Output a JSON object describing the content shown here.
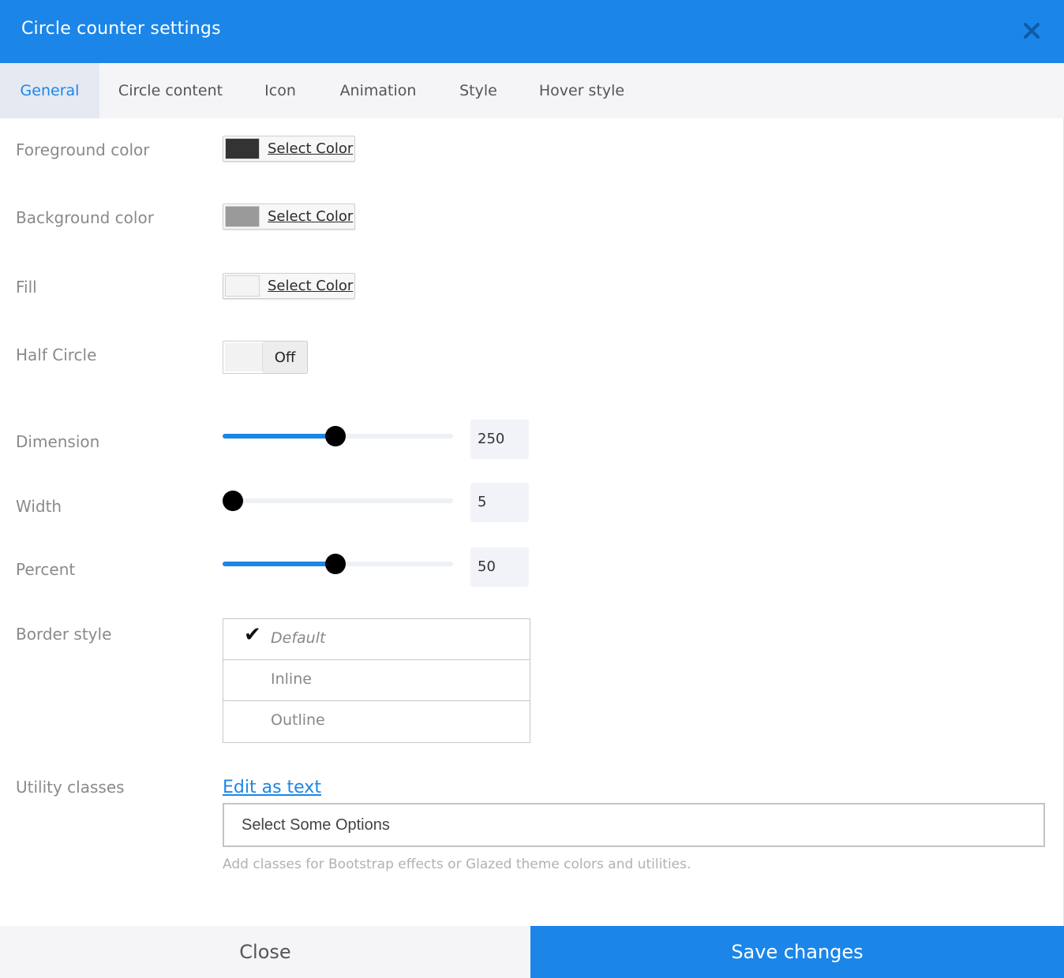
{
  "dialog": {
    "title": "Circle counter settings",
    "close_icon": "close-x-icon"
  },
  "tabs": [
    {
      "label": "General",
      "active": true
    },
    {
      "label": "Circle content",
      "active": false
    },
    {
      "label": "Icon",
      "active": false
    },
    {
      "label": "Animation",
      "active": false
    },
    {
      "label": "Style",
      "active": false
    },
    {
      "label": "Hover style",
      "active": false
    }
  ],
  "fields": {
    "foreground": {
      "label": "Foreground color",
      "button_text": "Select Color",
      "swatch_color": "#333333"
    },
    "background": {
      "label": "Background color",
      "button_text": "Select Color",
      "swatch_color": "#9a9a9a"
    },
    "fill": {
      "label": "Fill",
      "button_text": "Select Color",
      "swatch_color": "#f4f4f4"
    },
    "half_circle": {
      "label": "Half Circle",
      "state": "Off"
    },
    "dimension": {
      "label": "Dimension",
      "value": "250",
      "slider_fraction": 0.49
    },
    "width": {
      "label": "Width",
      "value": "5",
      "slider_fraction": 0.0
    },
    "percent": {
      "label": "Percent",
      "value": "50",
      "slider_fraction": 0.49
    },
    "border_style": {
      "label": "Border style",
      "options": [
        "Default",
        "Inline",
        "Outline"
      ],
      "selected": "Default"
    },
    "utility_classes": {
      "label": "Utility classes",
      "edit_link": "Edit as text",
      "placeholder": "Select Some Options",
      "help": "Add classes for Bootstrap effects or Glazed theme colors and utilities."
    }
  },
  "footer": {
    "close_label": "Close",
    "save_label": "Save changes"
  },
  "colors": {
    "accent": "#1b86e8",
    "tab_bar": "#f5f5f8",
    "slider_thumb": "#000000"
  }
}
